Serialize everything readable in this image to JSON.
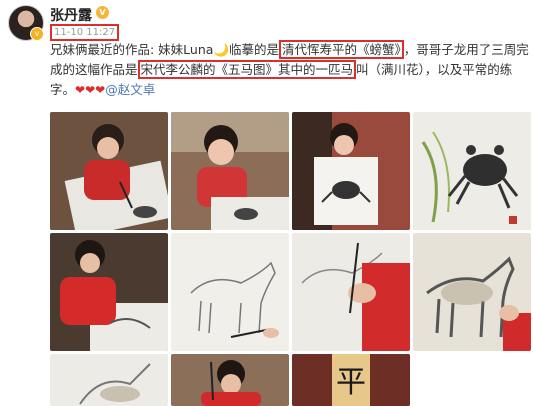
{
  "post": {
    "username": "张丹露",
    "vip_icon": "vip-badge-icon",
    "timestamp": "11-10 11:27",
    "text_part1": "兄妹俩最近的作品: 妹妹Luna",
    "moon_glyph": "🌙",
    "text_part2": "临摹的是",
    "highlight1": "清代恽寿平的《螃蟹》",
    "text_part3": "，哥哥子龙用了三周完成的这幅作品是",
    "highlight2": "宋代李公麟的《五马图》其中的一匹马",
    "text_part4": "叫（满川花），以及平常的练字。",
    "hearts": "❤❤❤",
    "mention": "@赵文卓"
  },
  "photos": [
    {
      "name": "photo-girl-painting-crab-1",
      "label": ""
    },
    {
      "name": "photo-girl-smiling-with-crab",
      "label": ""
    },
    {
      "name": "photo-girl-holding-crab-painting",
      "label": ""
    },
    {
      "name": "photo-crab-painting-closeup",
      "label": ""
    },
    {
      "name": "photo-boy-painting-1",
      "label": ""
    },
    {
      "name": "photo-horse-sketch",
      "label": ""
    },
    {
      "name": "photo-boy-brush-horse",
      "label": ""
    },
    {
      "name": "photo-horse-painting-finished",
      "label": ""
    },
    {
      "name": "photo-horse-painting-partial",
      "label": ""
    },
    {
      "name": "photo-boy-writing",
      "label": ""
    },
    {
      "name": "photo-calligraphy",
      "label": "平"
    }
  ]
}
